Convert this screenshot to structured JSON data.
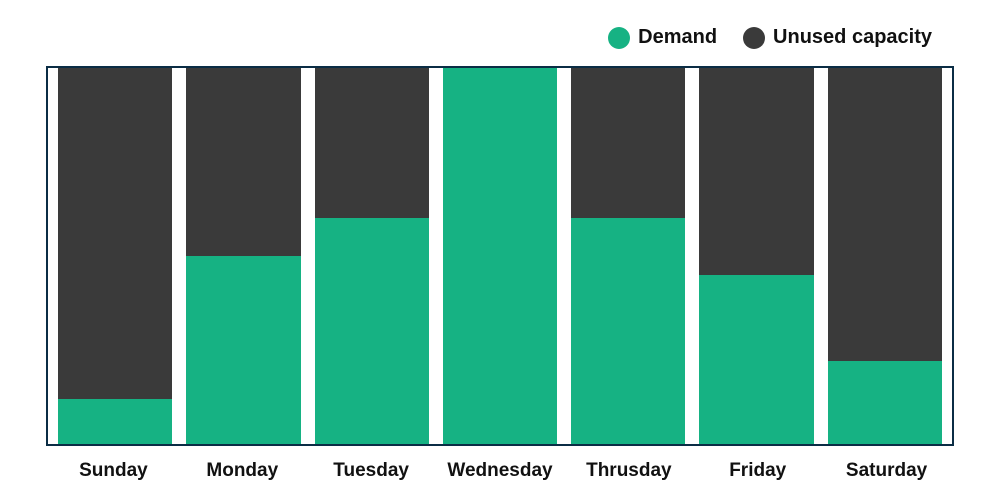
{
  "legend": {
    "items": [
      {
        "label": "Demand",
        "swatch": "demand"
      },
      {
        "label": "Unused capacity",
        "swatch": "unused"
      }
    ]
  },
  "chart_data": {
    "type": "bar",
    "stacked": true,
    "ylim": [
      0,
      100
    ],
    "categories": [
      "Sunday",
      "Monday",
      "Tuesday",
      "Wednesday",
      "Thrusday",
      "Friday",
      "Saturday"
    ],
    "series": [
      {
        "name": "Demand",
        "color": "#16b283",
        "values": [
          12,
          50,
          60,
          100,
          60,
          45,
          22
        ]
      },
      {
        "name": "Unused capacity",
        "color": "#3a3a3a",
        "values": [
          88,
          50,
          40,
          0,
          40,
          55,
          78
        ]
      }
    ]
  }
}
